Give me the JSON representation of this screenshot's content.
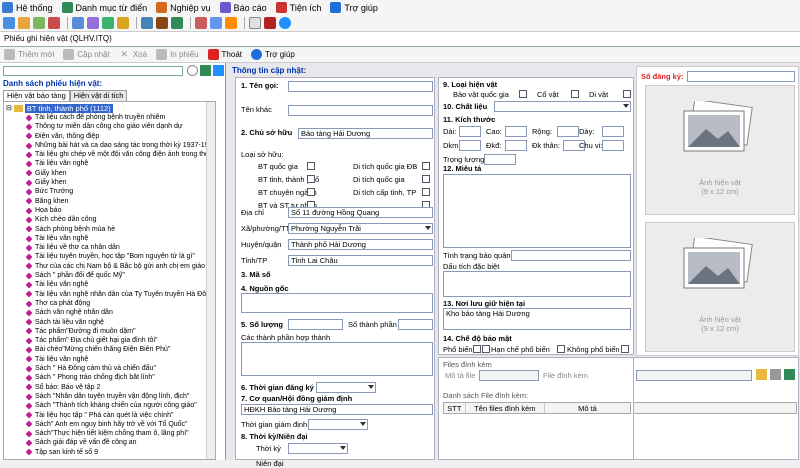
{
  "menubar": {
    "items": [
      {
        "label": "Hệ thống",
        "icon": "system-icon",
        "color": "#3a7bd5"
      },
      {
        "label": "Danh mục từ điển",
        "icon": "catalog-icon",
        "color": "#2e8b57"
      },
      {
        "label": "Nghiệp vụ",
        "icon": "workflow-icon",
        "color": "#d2691e"
      },
      {
        "label": "Báo cáo",
        "icon": "report-icon",
        "color": "#6a5acd"
      },
      {
        "label": "Tiện ích",
        "icon": "utility-icon",
        "color": "#cc3333"
      },
      {
        "label": "Trợ giúp",
        "icon": "help-icon",
        "color": "#1e6fd9"
      }
    ]
  },
  "document_tab": {
    "label": "Phiếu ghi hiện vật (QLHV.ITQ)"
  },
  "toolbar2": {
    "add": "Thêm mới",
    "update": "Cập nhật",
    "delete": "Xoá",
    "print": "In phiếu",
    "exit": "Thoát",
    "help": "Trợ giúp"
  },
  "left": {
    "title": "Danh sách phiếu hiện vật:",
    "tabs": [
      "Hiện vật bảo tàng",
      "Hiện vật di tích"
    ],
    "root": "BT tỉnh, thành phố (1112)",
    "items": [
      "Tài liệu cách để phòng bệnh truyền nhiễm",
      "Thông tư miễn dân công cho giáo viên dạnh dự",
      "Điện văn, thông điệp",
      "Những bài hát và ca dao sáng tác trong thời kỳ 1937-1938 của",
      "Tài liệu ghi chép về một đội văn công điện ảnh trong thời kỳ k",
      "Tài liệu văn nghệ",
      "Giấy khen",
      "Giấy khen",
      "Bức Trướng",
      "Bằng khen",
      "Họa báo",
      "Kịch chèo dân công",
      "Sách phòng bệnh mùa hè",
      "Tài liệu văn nghệ",
      "Tài liệu về thơ ca nhân dân",
      "Tài liệu tuyên truyền, học tập \"Bom nguyên tử là gì\"",
      "Thư của các chị Nam bộ & Bắc bộ gửi anh chị em giáo hữu",
      "Sách \" phần đổi để quốc Mỹ\"",
      "Tài liệu văn nghệ",
      "Tài liệu văn nghệ nhân dân của Ty Tuyên truyền Hà Đông xuất",
      "Thơ ca phát động",
      "Sách văn nghệ nhân dân",
      "Sách tài liệu văn nghệ",
      "Tác phẩm\"Đường đi muôn dặm\"",
      "Tác phẩm\" Địa chủ giết hại gia đình tôi\"",
      "Bài chèo\"Mừng chiến thắng Điện Biên Phủ\"",
      "Tài liệu văn nghệ",
      "Sách \" Hà Đông cảm thù và chiến đấu\"",
      "Sách \" Phong trào chống địch bắt lính\"",
      "Sổ báo: Báo vệ tập 2",
      "Sách \"Nhân dân tuyên truyền vận động lính, địch\"",
      "Sách \"Thành tích kháng chiến của người công giáo\"",
      "Tài liệu học tập \" Phá càn quét là việc chính\"",
      "Sách\" Anh em nguy binh hãy trở về với Tổ Quốc\"",
      "Sách\"Thực hiện tiết kiệm chống tham ô, lãng phí\"",
      "Sách giải đáp về vấn đề công an",
      "Tập san kinh tế số 9"
    ]
  },
  "form": {
    "title": "Thông tin cập nhật:",
    "s1": "1. Tên gọi:",
    "other_name": "Tên khác",
    "s2": "2. Chủ sở hữu",
    "owner": "Bảo tàng Hải Dương",
    "owner_type": "Loại sở hữu:",
    "own_opts": [
      "BT quốc gia",
      "BT tỉnh, thành phố",
      "BT chuyên ngành",
      "BT và ST tư nhân",
      "Di tích quốc gia ĐB",
      "Di tích quốc gia",
      "Di tích cấp tỉnh, TP"
    ],
    "address_label": "Địa chỉ",
    "address": "Số 11 đường Hồng Quang",
    "ward_label": "Xã/phường/TT",
    "ward": "Phường Nguyễn Trãi",
    "district_label": "Huyện/quận",
    "district": "Thành phố Hải Dương",
    "province_label": "Tỉnh/TP",
    "province": "Tỉnh Lai Châu",
    "s3": "3. Mã số",
    "s4": "4. Nguồn gốc",
    "s5": "5. Số lượng",
    "parts_count": "Số thành phần",
    "parts": "Các thành phần hợp thành",
    "s6": "6. Thời gian đăng ký",
    "s7": "7. Cơ quan/Hội đồng giám định",
    "council": "HĐKH Bảo tàng Hải Dương",
    "appraisal_time": "Thời gian giám định",
    "s8": "8. Thời kỳ/Niên đại",
    "period": "Thời kỳ",
    "era": "Niên đại",
    "s9": "9. Loại hiện vật",
    "type_opts": [
      "Bảo vật quốc gia",
      "Cổ vật",
      "Di vật"
    ],
    "s10": "10. Chất liệu",
    "s11": "11. Kích thước",
    "dims": [
      "Dài:",
      "Cao:",
      "Rộng:",
      "Dày:",
      "Dkm:",
      "Đkđ:",
      "Đk thân:",
      "Chu vi:"
    ],
    "weight": "Trọng lượng",
    "s12": "12. Miêu tả",
    "preservation": "Tình trạng bảo quản",
    "special": "Dấu tích đặc biệt",
    "s13": "13. Nơi lưu giữ hiện tại",
    "storage": "Kho bảo tàng Hải Dương",
    "s14": "14. Chế độ bảo mật",
    "secrecy_opts": [
      "Phổ biến",
      "Hạn chế phổ biến",
      "Không phổ biến"
    ],
    "files_title": "Files đính kèm",
    "file_desc": "Mô tả file",
    "file_attach": "File đính kèm",
    "files_list": "Danh sách File đính kèm:",
    "cols": [
      "STT",
      "Tên files đính kèm",
      "Mô tả"
    ]
  },
  "right": {
    "reg_label": "Số đăng ký:",
    "photo_caption": "Ảnh hiện vật",
    "photo_size": "(9 x 12 cm)",
    "reg_color": "#e02020"
  }
}
